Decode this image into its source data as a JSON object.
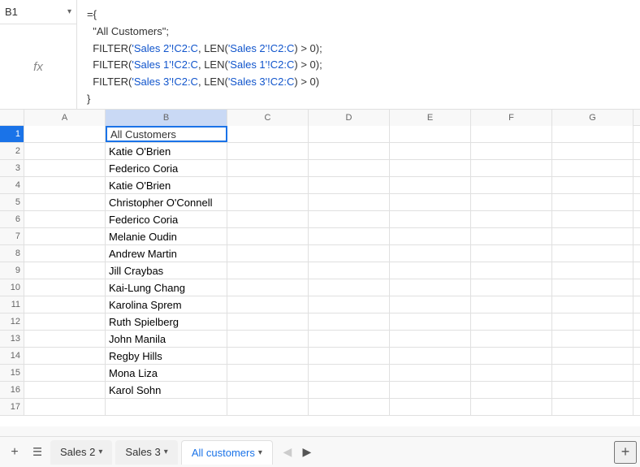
{
  "formula_bar": {
    "cell_ref": "B1",
    "formula_lines": [
      "={",
      "  \"All Customers\";",
      "  FILTER('Sales 2'!C2:C, LEN('Sales 2'!C2:C) > 0);",
      "  FILTER('Sales 1'!C2:C, LEN('Sales 1'!C2:C) > 0);",
      "  FILTER('Sales 3'!C2:C, LEN('Sales 3'!C2:C) > 0)",
      "}"
    ]
  },
  "columns": [
    {
      "label": "",
      "id": "row-num"
    },
    {
      "label": "A",
      "id": "A"
    },
    {
      "label": "B",
      "id": "B"
    },
    {
      "label": "C",
      "id": "C"
    },
    {
      "label": "D",
      "id": "D"
    },
    {
      "label": "E",
      "id": "E"
    },
    {
      "label": "F",
      "id": "F"
    },
    {
      "label": "G",
      "id": "G"
    }
  ],
  "rows": [
    {
      "num": "1",
      "b": "All Customers",
      "active": true
    },
    {
      "num": "2",
      "b": "Katie O'Brien"
    },
    {
      "num": "3",
      "b": "Federico Coria"
    },
    {
      "num": "4",
      "b": "Katie O'Brien"
    },
    {
      "num": "5",
      "b": "Christopher O'Connell"
    },
    {
      "num": "6",
      "b": "Federico Coria"
    },
    {
      "num": "7",
      "b": "Melanie Oudin"
    },
    {
      "num": "8",
      "b": "Andrew Martin"
    },
    {
      "num": "9",
      "b": "Jill Craybas"
    },
    {
      "num": "10",
      "b": "Kai-Lung Chang"
    },
    {
      "num": "11",
      "b": "Karolina Sprem"
    },
    {
      "num": "12",
      "b": "Ruth Spielberg"
    },
    {
      "num": "13",
      "b": "John Manila"
    },
    {
      "num": "14",
      "b": "Regby Hills"
    },
    {
      "num": "15",
      "b": "Mona Liza"
    },
    {
      "num": "16",
      "b": "Karol Sohn"
    },
    {
      "num": "17",
      "b": ""
    }
  ],
  "tabs": [
    {
      "label": "Sales 2",
      "active": false
    },
    {
      "label": "Sales 3",
      "active": false
    },
    {
      "label": "All customers",
      "active": true
    }
  ],
  "ui": {
    "add_sheet_label": "+",
    "nav_left": "◀",
    "nav_right": "▶",
    "tab_arrow": "▾",
    "fx_symbol": "fx"
  }
}
